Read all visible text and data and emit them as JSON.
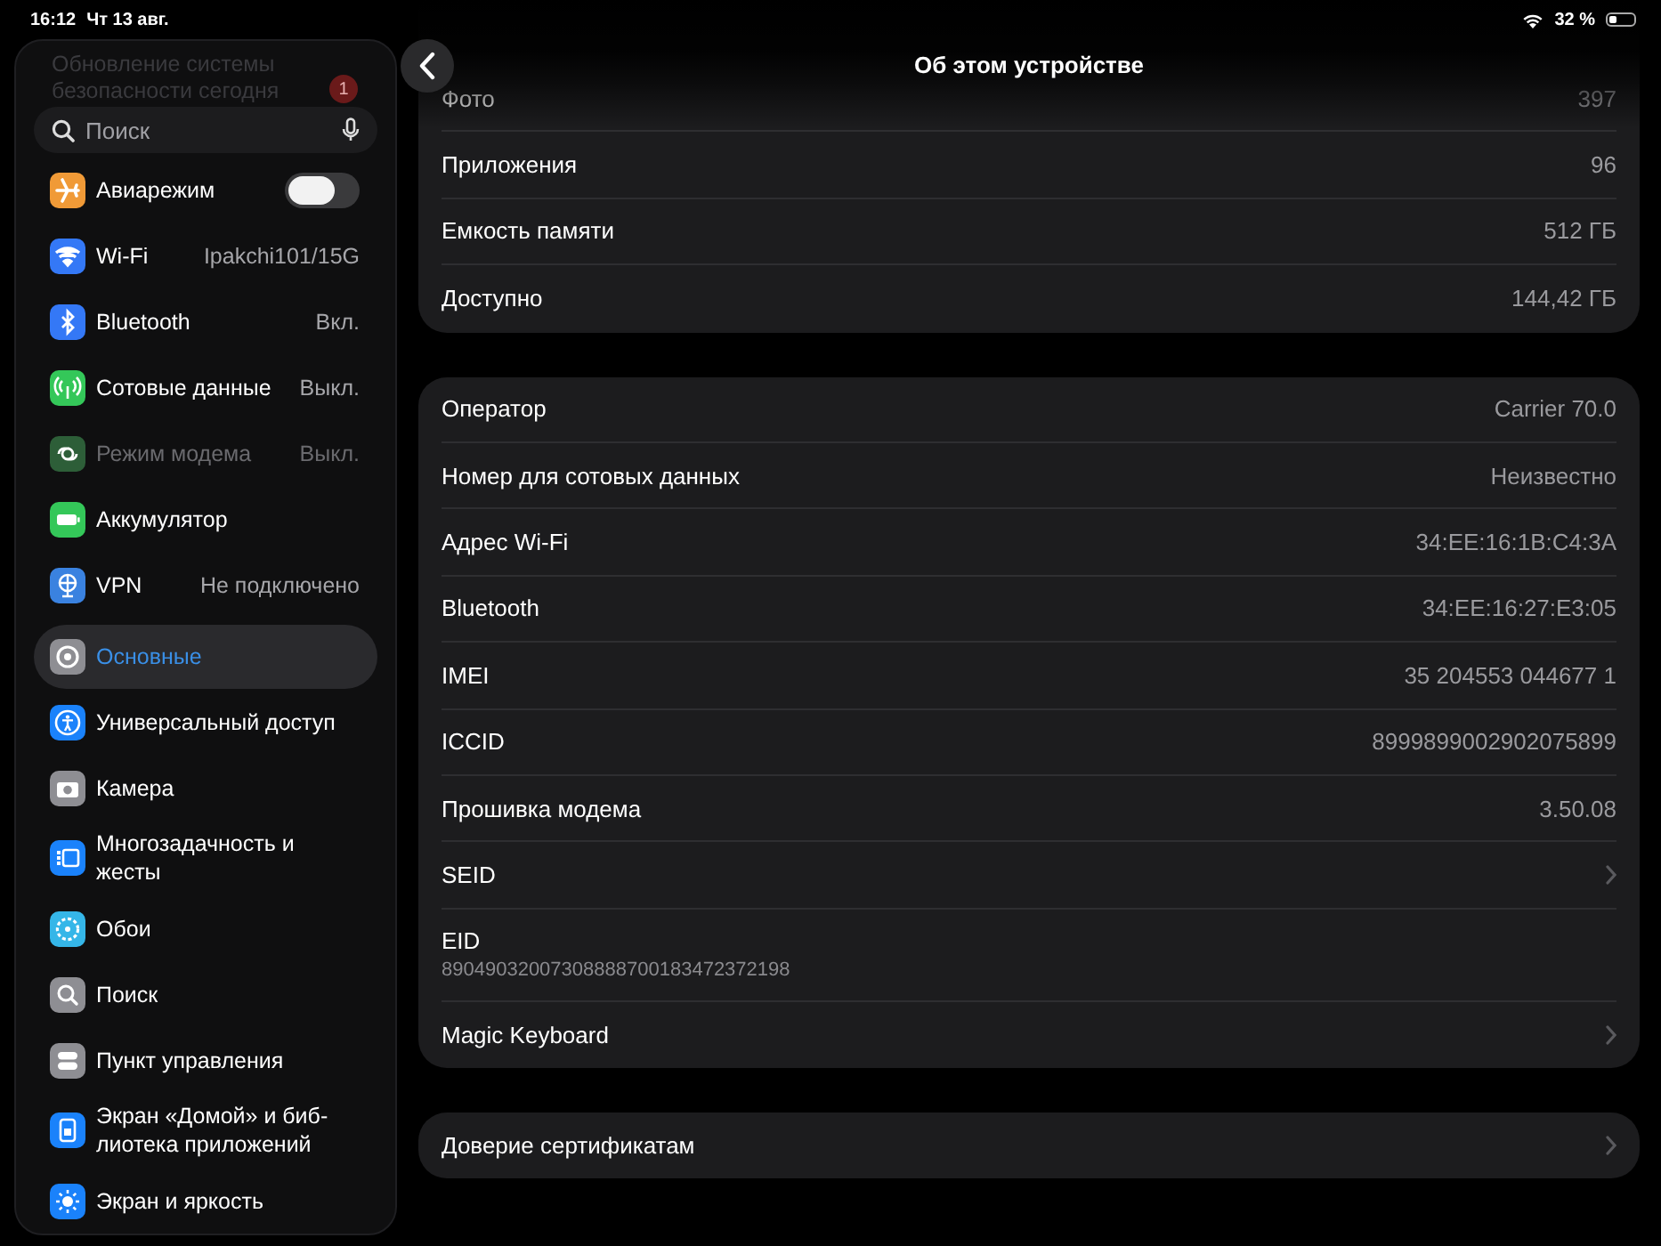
{
  "status_bar": {
    "time": "16:12",
    "date": "Чт 13 авг.",
    "battery_text": "32 %"
  },
  "sidebar": {
    "update_notice": {
      "text": "Обновление системы безопасности сегодня",
      "badge": "1"
    },
    "search": {
      "placeholder": "Поиск"
    },
    "groups": [
      {
        "items": [
          {
            "label": "Авиарежим",
            "kind": "toggle",
            "on": false,
            "color": "#f09a37",
            "disabled": false,
            "selected": false
          },
          {
            "label": "Wi-Fi",
            "kind": "value",
            "value": "Ipakchi101/15G",
            "color": "#3478f6",
            "disabled": false,
            "selected": false
          },
          {
            "label": "Bluetooth",
            "kind": "value",
            "value": "Вкл.",
            "color": "#3478f6",
            "disabled": false,
            "selected": false
          },
          {
            "label": "Сотовые данные",
            "kind": "value",
            "value": "Выкл.",
            "color": "#34c759",
            "disabled": false,
            "selected": false
          },
          {
            "label": "Режим модема",
            "kind": "value",
            "value": "Выкл.",
            "color": "#2d5e38",
            "disabled": true,
            "selected": false
          },
          {
            "label": "Аккумулятор",
            "kind": "plain",
            "color": "#34c759",
            "disabled": false,
            "selected": false
          },
          {
            "label": "VPN",
            "kind": "value",
            "value": "Не подключено",
            "color": "#3a82e0",
            "disabled": false,
            "selected": false
          }
        ]
      },
      {
        "items": [
          {
            "label": "Основные",
            "kind": "plain",
            "color": "#8e8e93",
            "disabled": false,
            "selected": true
          },
          {
            "label": "Универсальный доступ",
            "kind": "plain",
            "color": "#1a82fb",
            "disabled": false,
            "selected": false
          },
          {
            "label": "Камера",
            "kind": "plain",
            "color": "#8e8e93",
            "disabled": false,
            "selected": false
          },
          {
            "label": "Многозадачность и жесты",
            "kind": "plain",
            "color": "#1a82fb",
            "disabled": false,
            "selected": false
          },
          {
            "label": "Обои",
            "kind": "plain",
            "color": "#35b6e8",
            "disabled": false,
            "selected": false
          },
          {
            "label": "Поиск",
            "kind": "plain",
            "color": "#8e8e93",
            "disabled": false,
            "selected": false
          },
          {
            "label": "Пункт управления",
            "kind": "plain",
            "color": "#8e8e93",
            "disabled": false,
            "selected": false
          },
          {
            "label": "Экран «Домой» и биб-лиотека приложений",
            "kind": "plain",
            "color": "#1a82fb",
            "disabled": false,
            "selected": false
          },
          {
            "label": "Экран и яркость",
            "kind": "plain",
            "color": "#1a82fb",
            "disabled": false,
            "selected": false
          }
        ]
      }
    ]
  },
  "header": {
    "title": "Об этом устройстве"
  },
  "groups": [
    {
      "rows": [
        {
          "label": "Фото",
          "kind": "value",
          "value": "397"
        },
        {
          "label": "Приложения",
          "kind": "value",
          "value": "96"
        },
        {
          "label": "Емкость памяти",
          "kind": "value",
          "value": "512 ГБ"
        },
        {
          "label": "Доступно",
          "kind": "value",
          "value": "144,42 ГБ"
        }
      ]
    },
    {
      "rows": [
        {
          "label": "Оператор",
          "kind": "value",
          "value": "Carrier 70.0"
        },
        {
          "label": "Номер для сотовых данных",
          "kind": "value",
          "value": "Неизвестно"
        },
        {
          "label": "Адрес Wi-Fi",
          "kind": "value",
          "value": "34:EE:16:1B:C4:3A"
        },
        {
          "label": "Bluetooth",
          "kind": "value",
          "value": "34:EE:16:27:E3:05"
        },
        {
          "label": "IMEI",
          "kind": "value",
          "value": "35 204553 044677 1"
        },
        {
          "label": "ICCID",
          "kind": "value",
          "value": "8999899002902075899"
        },
        {
          "label": "Прошивка модема",
          "kind": "value",
          "value": "3.50.08"
        },
        {
          "label": "SEID",
          "kind": "link"
        },
        {
          "label": "EID",
          "kind": "subtitle",
          "value": "89049032007308888700183472372198"
        },
        {
          "label": "Magic Keyboard",
          "kind": "link"
        }
      ]
    },
    {
      "rows": [
        {
          "label": "Доверие сертификатам",
          "kind": "link"
        }
      ]
    }
  ]
}
